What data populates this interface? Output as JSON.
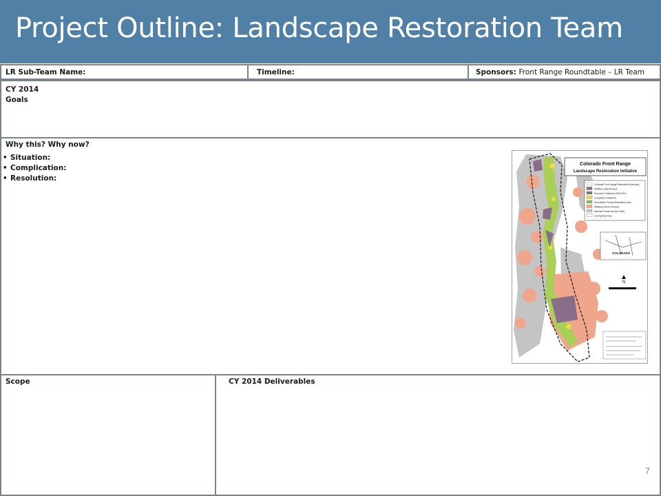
{
  "title": "Project Outline: Landscape Restoration Team",
  "top_row": {
    "subteam_label": "LR Sub-Team Name:",
    "timeline_label": "Timeline:",
    "sponsors_label": "Sponsors:",
    "sponsors_value": "Front Range Roundtable – LR Team"
  },
  "goals": {
    "year": "CY 2014",
    "label": "Goals"
  },
  "why": {
    "heading": "Why this? Why now?",
    "bullets": [
      "Situation:",
      "Complication:",
      "Resolution:"
    ],
    "bullet_glyph": "•"
  },
  "map": {
    "title_line1": "Colorado Front Range",
    "title_line2": "Landscape Restoration Initiative",
    "legend": [
      {
        "label": "Colorado Front Range Restoration Boundary",
        "color": "#ffffff"
      },
      {
        "label": "Wildfires 1996-Present",
        "color": "#8e6d8c"
      },
      {
        "label": "Proposed Treatment 2015-2016",
        "color": "#7e7a73"
      },
      {
        "label": "Completed Treatment",
        "color": "#e7e23c"
      },
      {
        "label": "Roundtable Priority Restoration Area",
        "color": "#8dc04a"
      },
      {
        "label": "Wildland-Urban Interface",
        "color": "#f2a98e"
      },
      {
        "label": "National Forest Service Lands",
        "color": "#c9c9c9"
      },
      {
        "label": "County Boundary",
        "color": "#ffffff"
      }
    ],
    "inset_label": "COLORADO",
    "north": "N",
    "colors": {
      "gray": "#c4c4c4",
      "salmon": "#f0a68c",
      "green": "#a9cf58",
      "yellow": "#e6e043",
      "purple": "#8a6d89",
      "brown": "#7a6a60"
    }
  },
  "scope": {
    "label": "Scope"
  },
  "deliverables": {
    "label": "CY 2014 Deliverables"
  },
  "page_number": "7",
  "colors": {
    "header": "#5080a5",
    "border": "#78828c"
  }
}
